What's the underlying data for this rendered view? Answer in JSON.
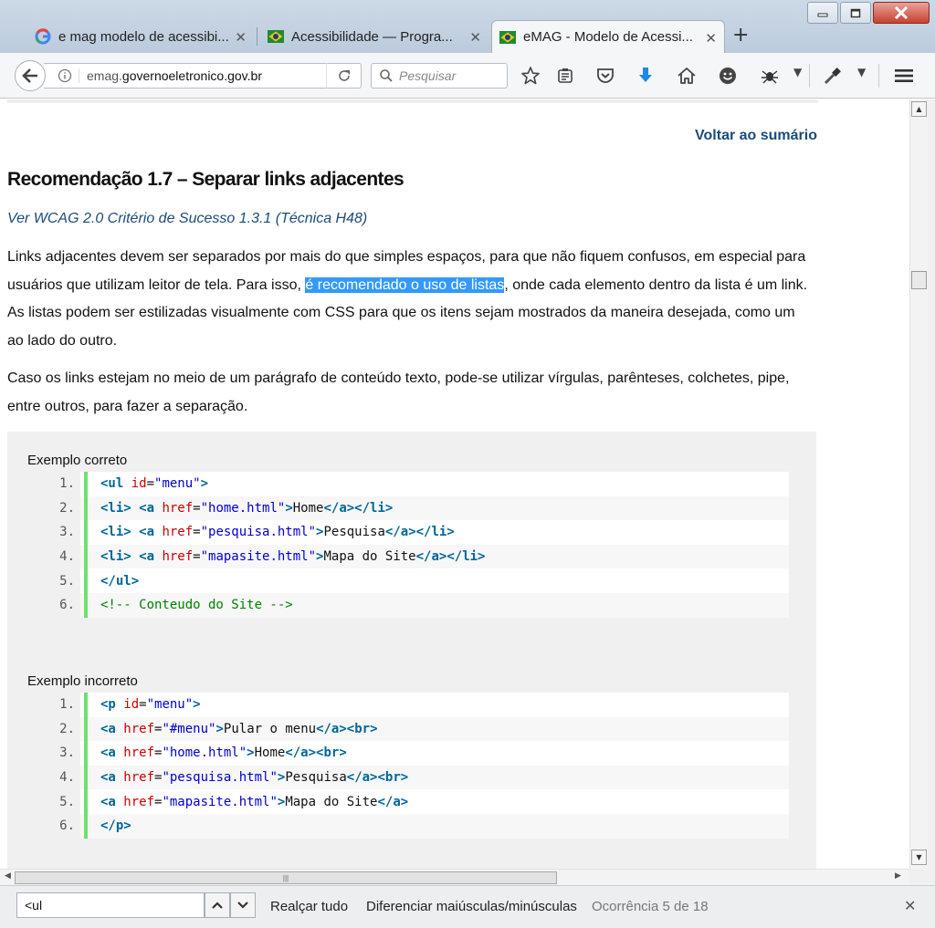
{
  "browser": {
    "tabs": [
      {
        "title": "e mag modelo de acessibi...",
        "favicon": "google-g-icon",
        "active": false
      },
      {
        "title": "Acessibilidade — Progra...",
        "favicon": "brazil-flag-icon",
        "active": false
      },
      {
        "title": "eMAG - Modelo de Acessi...",
        "favicon": "brazil-flag-icon",
        "active": true
      }
    ],
    "url_prefix": "emag.",
    "url_domain": "governoeletronico.gov.br",
    "search_placeholder": "Pesquisar"
  },
  "content": {
    "voltar": "Voltar ao sumário",
    "title": "Recomendação 1.7 – Separar links adjacentes",
    "wcag_link": "Ver WCAG 2.0 Critério de Sucesso 1.3.1 (Técnica H48)",
    "p1_before": "Links adjacentes devem ser separados por mais do que simples espaços, para que não fiquem confusos, em especial para usuários que utilizam leitor de tela. Para isso, ",
    "p1_highlight": "é recomendado o uso de listas",
    "p1_after": ", onde cada elemento dentro da lista é um link. As listas podem ser estilizadas visualmente com CSS para que os itens sejam mostrados da maneira desejada, como um ao lado do outro.",
    "p2": "Caso os links estejam no meio de um parágrafo de conteúdo texto, pode-se utilizar vírgulas, parênteses, colchetes, pipe, entre outros, para fazer a separação.",
    "example_correct_label": "Exemplo correto",
    "example_incorrect_label": "Exemplo incorreto",
    "example_correct": [
      {
        "n": "1.",
        "tokens": [
          [
            "k",
            "<ul "
          ],
          [
            "a",
            "id"
          ],
          [
            "t",
            "="
          ],
          [
            "s",
            "\"menu\""
          ],
          [
            "k",
            ">"
          ]
        ]
      },
      {
        "n": "2.",
        "tokens": [
          [
            "k",
            "<li> <a "
          ],
          [
            "a",
            "href"
          ],
          [
            "t",
            "="
          ],
          [
            "s",
            "\"home.html\""
          ],
          [
            "k",
            ">"
          ],
          [
            "t",
            "Home"
          ],
          [
            "k",
            "</a></li>"
          ]
        ]
      },
      {
        "n": "3.",
        "tokens": [
          [
            "k",
            "<li> <a "
          ],
          [
            "a",
            "href"
          ],
          [
            "t",
            "="
          ],
          [
            "s",
            "\"pesquisa.html\""
          ],
          [
            "k",
            ">"
          ],
          [
            "t",
            "Pesquisa"
          ],
          [
            "k",
            "</a></li>"
          ]
        ]
      },
      {
        "n": "4.",
        "tokens": [
          [
            "k",
            "<li> <a "
          ],
          [
            "a",
            "href"
          ],
          [
            "t",
            "="
          ],
          [
            "s",
            "\"mapasite.html\""
          ],
          [
            "k",
            ">"
          ],
          [
            "t",
            "Mapa do Site"
          ],
          [
            "k",
            "</a></li>"
          ]
        ]
      },
      {
        "n": "5.",
        "tokens": [
          [
            "k",
            "</ul>"
          ]
        ]
      },
      {
        "n": "6.",
        "tokens": [
          [
            "c",
            "<!-- Conteudo do Site -->"
          ]
        ]
      }
    ],
    "example_incorrect": [
      {
        "n": "1.",
        "tokens": [
          [
            "k",
            "<p "
          ],
          [
            "a",
            "id"
          ],
          [
            "t",
            "="
          ],
          [
            "s",
            "\"menu\""
          ],
          [
            "k",
            ">"
          ]
        ]
      },
      {
        "n": "2.",
        "tokens": [
          [
            "k",
            "<a "
          ],
          [
            "a",
            "href"
          ],
          [
            "t",
            "="
          ],
          [
            "s",
            "\"#menu\""
          ],
          [
            "k",
            ">"
          ],
          [
            "t",
            "Pular o menu"
          ],
          [
            "k",
            "</a><br>"
          ]
        ]
      },
      {
        "n": "3.",
        "tokens": [
          [
            "k",
            "<a "
          ],
          [
            "a",
            "href"
          ],
          [
            "t",
            "="
          ],
          [
            "s",
            "\"home.html\""
          ],
          [
            "k",
            ">"
          ],
          [
            "t",
            "Home"
          ],
          [
            "k",
            "</a><br>"
          ]
        ]
      },
      {
        "n": "4.",
        "tokens": [
          [
            "k",
            "<a "
          ],
          [
            "a",
            "href"
          ],
          [
            "t",
            "="
          ],
          [
            "s",
            "\"pesquisa.html\""
          ],
          [
            "k",
            ">"
          ],
          [
            "t",
            "Pesquisa"
          ],
          [
            "k",
            "</a><br>"
          ]
        ]
      },
      {
        "n": "5.",
        "tokens": [
          [
            "k",
            "<a "
          ],
          [
            "a",
            "href"
          ],
          [
            "t",
            "="
          ],
          [
            "s",
            "\"mapasite.html\""
          ],
          [
            "k",
            ">"
          ],
          [
            "t",
            "Mapa do Site"
          ],
          [
            "k",
            "</a>"
          ]
        ]
      },
      {
        "n": "6.",
        "tokens": [
          [
            "k",
            "</p>"
          ]
        ]
      }
    ]
  },
  "findbar": {
    "query": "<ul",
    "highlight_all": "Realçar tudo",
    "match_case": "Diferenciar maiúsculas/minúsculas",
    "status": "Ocorrência 5 de 18"
  },
  "colors": {
    "selection": "#3399ff",
    "link": "#1b4b7a",
    "code_gutter_bar": "#6ce26c",
    "code_keyword": "#006699",
    "code_attr": "#cc0000",
    "code_string": "#0000cc",
    "code_comment": "#008200"
  }
}
